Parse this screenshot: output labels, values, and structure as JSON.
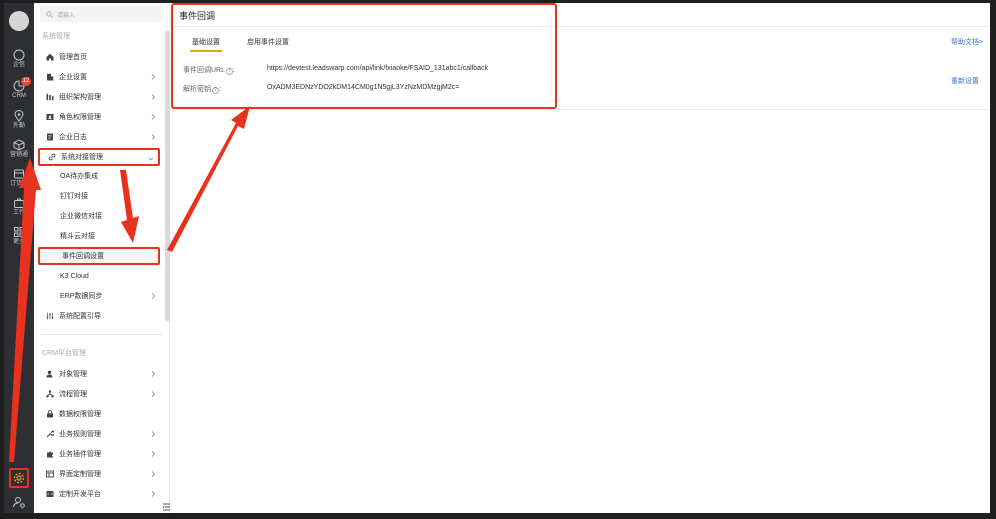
{
  "search": {
    "placeholder": "请输入"
  },
  "rail": {
    "items": [
      {
        "label": "企信",
        "icon": "chat-bubble-icon"
      },
      {
        "label": "CRM",
        "icon": "crm-icon",
        "badge": "12"
      },
      {
        "label": "外勤",
        "icon": "location-pin-icon"
      },
      {
        "label": "营销通",
        "icon": "box-icon"
      },
      {
        "label": "订货通",
        "icon": "store-icon"
      },
      {
        "label": "工作",
        "icon": "briefcase-icon"
      },
      {
        "label": "更多",
        "icon": "grid-icon"
      }
    ]
  },
  "sidebar": {
    "section1_title": "系统管理",
    "section2_title": "CRM平台管理",
    "items": [
      {
        "label": "管理首页",
        "icon": "home-icon",
        "chevron": false
      },
      {
        "label": "企业设置",
        "icon": "building-icon",
        "chevron": true
      },
      {
        "label": "组织架构管理",
        "icon": "org-chart-icon",
        "chevron": true
      },
      {
        "label": "角色权限管理",
        "icon": "id-card-icon",
        "chevron": true
      },
      {
        "label": "企业日志",
        "icon": "document-icon",
        "chevron": true
      },
      {
        "label": "系统对接管理",
        "icon": "link-icon",
        "chevron": true
      }
    ],
    "sub_items": [
      {
        "label": "OA待办集成"
      },
      {
        "label": "钉钉对接"
      },
      {
        "label": "企业微信对接"
      },
      {
        "label": "精斗云对接"
      },
      {
        "label": "事件回调设置"
      },
      {
        "label": "K3 Cloud"
      },
      {
        "label": "ERP数据同步"
      }
    ],
    "config_guide": "系统配置引导",
    "crm_items": [
      {
        "label": "对象管理",
        "icon": "user-gear-icon"
      },
      {
        "label": "流程管理",
        "icon": "flow-icon"
      },
      {
        "label": "数据权限管理",
        "icon": "lock-icon"
      },
      {
        "label": "业务规则管理",
        "icon": "wrench-icon"
      },
      {
        "label": "业务插件管理",
        "icon": "puzzle-icon"
      },
      {
        "label": "界面定制管理",
        "icon": "layout-icon"
      },
      {
        "label": "定制开发平台",
        "icon": "code-icon"
      }
    ]
  },
  "main": {
    "title": "事件回调",
    "tabs": [
      {
        "label": "基础设置"
      },
      {
        "label": "启用事件设置"
      }
    ],
    "help_link": "帮助文档>",
    "reset_link": "重新设置",
    "fields": [
      {
        "label": "事件回调URL",
        "value": "https://devtest.leadswarp.com/api/link/fxiaoke/FSAID_131abc1/callback"
      },
      {
        "label": "解析密钥",
        "value": "OxADM3EDNzYDO2kDM14CM0g1N5gjL3YzNzMDMzgjM2c="
      }
    ]
  },
  "colors": {
    "annotation_red": "#e8321e",
    "tab_active": "#e8a317",
    "link_blue": "#3a74c9",
    "rail_bg": "#2e2f33"
  }
}
